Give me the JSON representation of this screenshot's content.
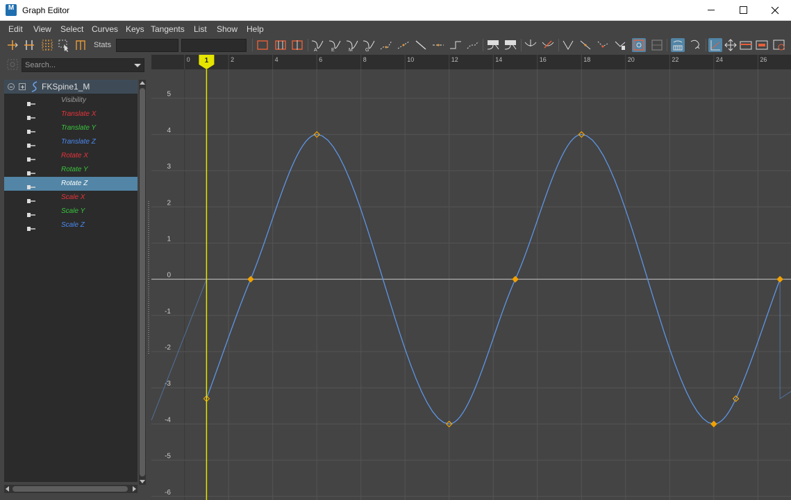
{
  "window": {
    "title": "Graph Editor",
    "app_icon_letter": "M",
    "controls": [
      "minimize",
      "maximize",
      "close"
    ]
  },
  "menubar": [
    "Edit",
    "View",
    "Select",
    "Curves",
    "Keys",
    "Tangents",
    "List",
    "Show",
    "Help"
  ],
  "toolbar": {
    "stats_label": "Stats",
    "stats_field_1": "",
    "stats_field_2": "",
    "icons": [
      "move-key-icon",
      "insert-key-icon",
      "lattice-deform-icon",
      "region-select-icon",
      "retime-icon",
      "frame-all-icon",
      "frame-playback-icon",
      "center-current-time-icon",
      "auto-tangent-icon",
      "spline-tangent-icon",
      "clamped-tangent-icon",
      "linear-tangent-icon",
      "flat-tangent-icon",
      "step-tangent-icon",
      "plateau-tangent-icon",
      "break-tangents-icon",
      "unify-tangents-icon",
      "free-tangent-weight-icon",
      "lock-tangent-weight-icon",
      "auto-load-icon",
      "load-selected-icon",
      "pre-infinity-cycle-icon",
      "post-infinity-cycle-icon",
      "buffer-curve-snapshot-icon",
      "swap-buffer-curves-icon",
      "normalize-icon",
      "denormalize-icon",
      "stacked-view-icon",
      "absolute-view-icon",
      "isolate-curve-icon",
      "time-snap-icon",
      "value-snap-icon",
      "dope-sheet-icon",
      "time-editor-icon",
      "curve-settings-icon"
    ],
    "active_icons": [
      "stacked-view-icon",
      "auto-load-icon",
      "curve-settings-icon"
    ]
  },
  "outliner": {
    "search_placeholder": "Search...",
    "root_node": "FKSpine1_M",
    "attributes": [
      {
        "label": "Visibility",
        "color": "#9a9a9a",
        "selected": false
      },
      {
        "label": "Translate X",
        "color": "#e8333a",
        "selected": false
      },
      {
        "label": "Translate Y",
        "color": "#38c43c",
        "selected": false
      },
      {
        "label": "Translate Z",
        "color": "#4a89f0",
        "selected": false
      },
      {
        "label": "Rotate X",
        "color": "#e8333a",
        "selected": false
      },
      {
        "label": "Rotate Y",
        "color": "#38c43c",
        "selected": false
      },
      {
        "label": "Rotate Z",
        "color": "#ffffff",
        "selected": true
      },
      {
        "label": "Scale X",
        "color": "#e8333a",
        "selected": false
      },
      {
        "label": "Scale Y",
        "color": "#38c43c",
        "selected": false
      },
      {
        "label": "Scale Z",
        "color": "#4a89f0",
        "selected": false
      }
    ]
  },
  "graph": {
    "current_frame": "1",
    "x_ticks": [
      "0",
      "2",
      "4",
      "6",
      "8",
      "10",
      "12",
      "14",
      "16",
      "18",
      "20",
      "22",
      "24",
      "26"
    ],
    "y_ticks": [
      "5",
      "4",
      "3",
      "2",
      "1",
      "0",
      "-1",
      "-2",
      "-3",
      "-4",
      "-5",
      "-6"
    ],
    "colors": {
      "background": "#444444",
      "grid": "#545454",
      "axis": "#c8c8c8",
      "curve": "#5d95e6",
      "key": "#f1a100",
      "time_marker": "#e5e500",
      "ruler": "#2e2e2e"
    }
  },
  "chart_data": {
    "type": "line",
    "xlabel": "",
    "ylabel": "",
    "xlim": [
      -1.5,
      27.5
    ],
    "ylim": [
      -6.1,
      5.8
    ],
    "grid": true,
    "series": [
      {
        "values_x": [
          1,
          3,
          6,
          12,
          15,
          18,
          24,
          25,
          27
        ],
        "values_y": [
          -3.3,
          0,
          4,
          -4,
          0,
          4,
          -4,
          -3.3,
          0
        ]
      }
    ],
    "keys": [
      {
        "frame": 1,
        "value": -3.3,
        "selected": false
      },
      {
        "frame": 3,
        "value": 0,
        "selected": true
      },
      {
        "frame": 6,
        "value": 4,
        "selected": false
      },
      {
        "frame": 12,
        "value": -4,
        "selected": false
      },
      {
        "frame": 15,
        "value": 0,
        "selected": true
      },
      {
        "frame": 18,
        "value": 4,
        "selected": false
      },
      {
        "frame": 24,
        "value": -4,
        "selected": true
      },
      {
        "frame": 25,
        "value": -3.3,
        "selected": false
      },
      {
        "frame": 27,
        "value": 0,
        "selected": true
      }
    ]
  }
}
